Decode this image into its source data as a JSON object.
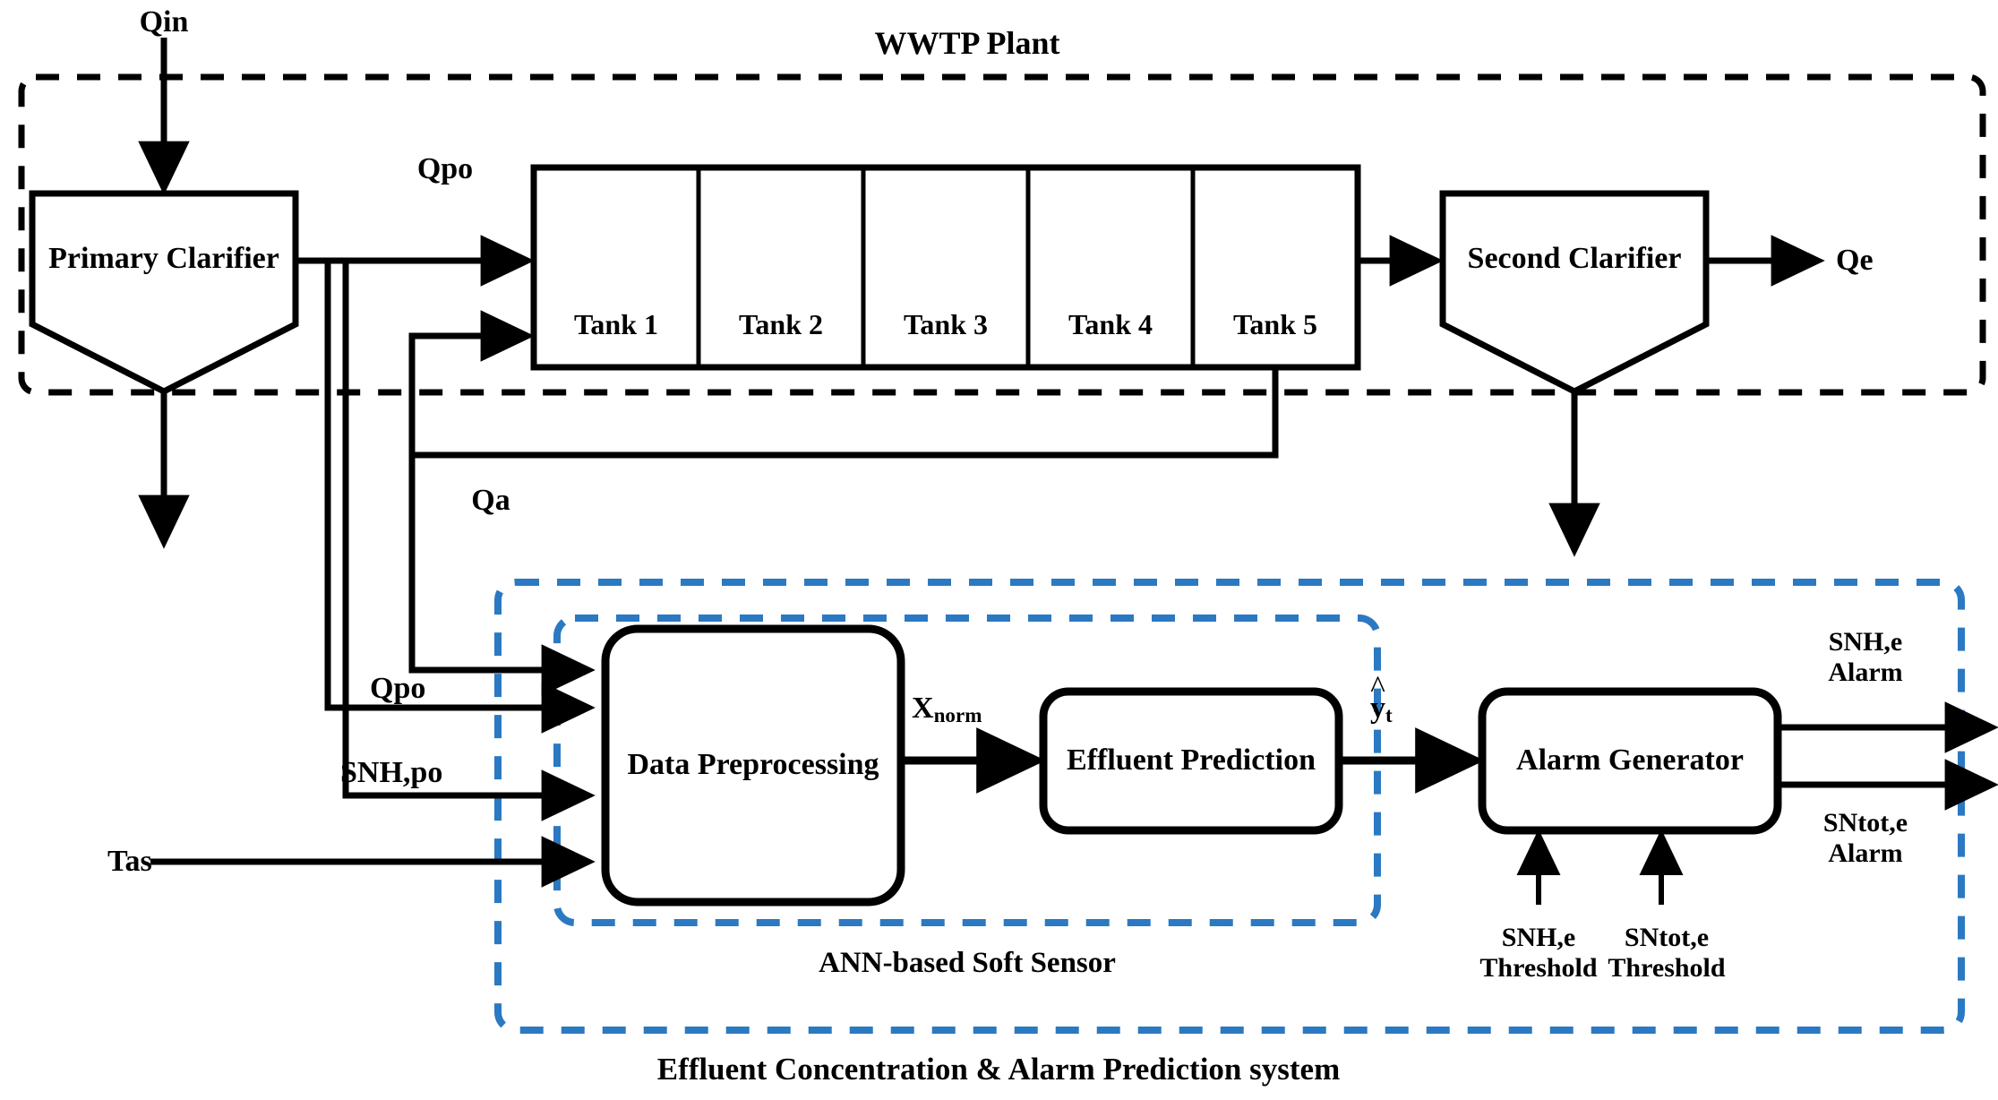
{
  "diagram": {
    "title": "WWTP Plant",
    "bottom_caption": "Effluent Concentration & Alarm Prediction system",
    "inner_caption": "ANN-based Soft Sensor",
    "colors": {
      "blue_dashed": "#2B79C2",
      "black": "#000000",
      "background": "#FFFFFF"
    }
  },
  "plant": {
    "primary_clarifier": "Primary Clarifier",
    "second_clarifier": "Second Clarifier",
    "tanks": [
      "Tank 1",
      "Tank 2",
      "Tank 3",
      "Tank 4",
      "Tank 5"
    ]
  },
  "flows": {
    "inlet": "Qin",
    "primary_out_top": "Qpo",
    "recirculation": "Qa",
    "effluent": "Qe",
    "sensor_qpo": "Qpo",
    "sensor_snh_po": "SNH,po",
    "sensor_tas": "Tas"
  },
  "soft_sensor": {
    "preprocessing": "Data Preprocessing",
    "prediction": "Effluent Prediction",
    "alarm": "Alarm Generator",
    "signal_xnorm": {
      "base": "X",
      "sub": "norm"
    },
    "signal_yhat": {
      "base": "y",
      "sub": "t",
      "accent": "^"
    }
  },
  "thresholds": [
    {
      "line1": "SNH,e",
      "line2": "Threshold"
    },
    {
      "line1": "SNtot,e",
      "line2": "Threshold"
    }
  ],
  "alarms": [
    {
      "line1": "SNH,e",
      "line2": "Alarm"
    },
    {
      "line1": "SNtot,e",
      "line2": "Alarm"
    }
  ]
}
